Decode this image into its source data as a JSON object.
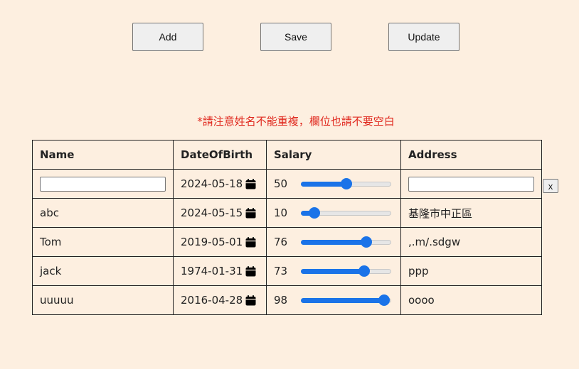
{
  "toolbar": {
    "add_label": "Add",
    "save_label": "Save",
    "update_label": "Update"
  },
  "notice": "*請注意姓名不能重複，欄位也請不要空白",
  "table": {
    "headers": {
      "name": "Name",
      "dob": "DateOfBirth",
      "salary": "Salary",
      "address": "Address"
    },
    "new_row": {
      "name": "",
      "dob": "2024-05-18",
      "salary": 50,
      "salary_text": "50",
      "address": "",
      "remove_label": "x"
    },
    "rows": [
      {
        "name": "abc",
        "dob": "2024-05-15",
        "salary": 10,
        "salary_text": "10",
        "address": "基隆市中正區"
      },
      {
        "name": "Tom",
        "dob": "2019-05-01",
        "salary": 76,
        "salary_text": "76",
        "address": ",.m/.sdgw"
      },
      {
        "name": "jack",
        "dob": "1974-01-31",
        "salary": 73,
        "salary_text": "73",
        "address": "ppp"
      },
      {
        "name": "uuuuu",
        "dob": "2016-04-28",
        "salary": 98,
        "salary_text": "98",
        "address": "oooo"
      }
    ]
  },
  "colors": {
    "accent": "#1a73e8",
    "notice": "#e0281e",
    "background": "#fdefe0"
  },
  "icons": {
    "date_picker": "calendar-icon"
  }
}
